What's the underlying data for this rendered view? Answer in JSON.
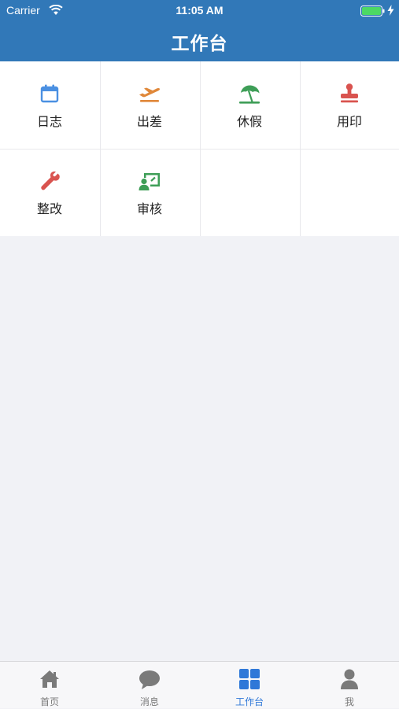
{
  "status_bar": {
    "carrier": "Carrier",
    "time": "11:05 AM"
  },
  "header": {
    "title": "工作台"
  },
  "grid": {
    "items": [
      {
        "label": "日志",
        "icon": "calendar-icon",
        "color": "#4a90e2"
      },
      {
        "label": "出差",
        "icon": "airplane-takeoff-icon",
        "color": "#e0883a"
      },
      {
        "label": "休假",
        "icon": "beach-umbrella-icon",
        "color": "#3e9e57"
      },
      {
        "label": "用印",
        "icon": "stamp-icon",
        "color": "#d9534f"
      },
      {
        "label": "整改",
        "icon": "wrench-icon",
        "color": "#d9534f"
      },
      {
        "label": "审核",
        "icon": "presentation-user-icon",
        "color": "#3e9e57"
      }
    ]
  },
  "tabbar": {
    "tabs": [
      {
        "label": "首页",
        "icon": "home-icon",
        "active": false
      },
      {
        "label": "消息",
        "icon": "chat-bubble-icon",
        "active": false
      },
      {
        "label": "工作台",
        "icon": "grid-icon",
        "active": true
      },
      {
        "label": "我",
        "icon": "user-icon",
        "active": false
      }
    ],
    "active_color": "#2f78d8",
    "inactive_color": "#7a7a7a"
  },
  "colors": {
    "header_bg": "#3178b8",
    "page_bg": "#f1f2f6"
  }
}
